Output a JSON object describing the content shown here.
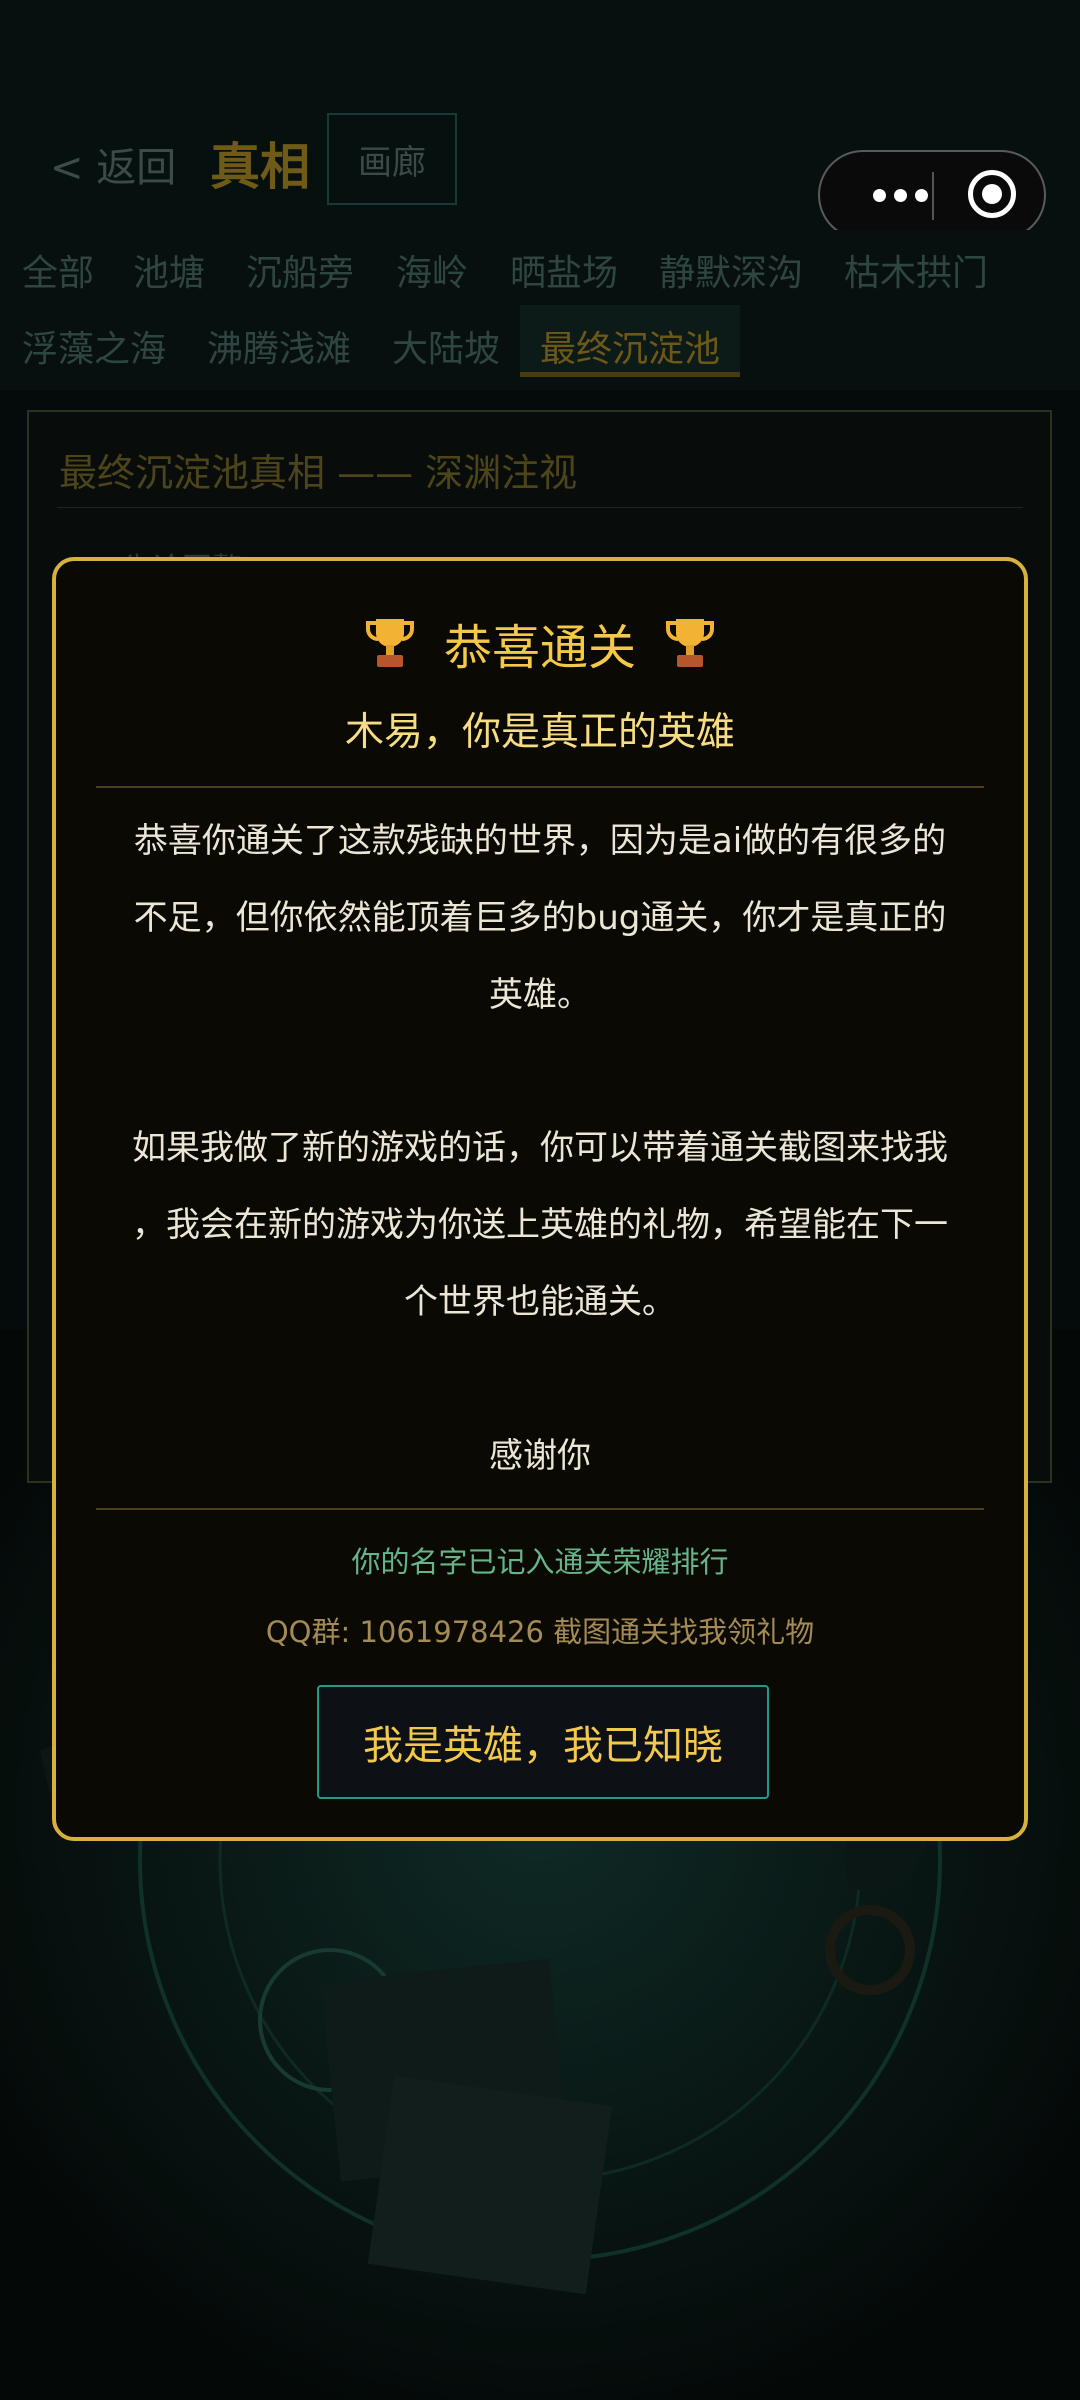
{
  "header": {
    "back_label": "< 返回",
    "title": "真相",
    "gallery_label": "画廊"
  },
  "capsule": {
    "more_icon": "more-dots-icon",
    "close_icon": "target-close-icon"
  },
  "tabs": [
    {
      "label": "全部"
    },
    {
      "label": "池塘"
    },
    {
      "label": "沉船旁"
    },
    {
      "label": "海岭"
    },
    {
      "label": "晒盐场"
    },
    {
      "label": "静默深沟"
    },
    {
      "label": "枯木拱门"
    },
    {
      "label": "浮藻之海"
    },
    {
      "label": "沸腾浅滩"
    },
    {
      "label": "大陆坡"
    },
    {
      "label": "最终沉淀池",
      "active": true
    }
  ],
  "content": {
    "heading": "最终沉淀池真相 —— 深渊注视",
    "card_label": "先论回赘"
  },
  "modal": {
    "title": "恭喜通关",
    "title_icon": "trophy-icon",
    "subtitle": "木易，你是真正的英雄",
    "paragraph1_lines": [
      "恭喜你通关了这款残缺的世界，因为是ai做的有很多的",
      "不足，但你依然能顶着巨多的bug通关，你才是真正的",
      "英雄。"
    ],
    "paragraph2_lines": [
      "如果我做了新的游戏的话，你可以带着通关截图来找我",
      "，我会在新的游戏为你送上英雄的礼物，希望能在下一",
      "个世界也能通关。"
    ],
    "thanks": "感谢你",
    "honor_text": "你的名字已记入通关荣耀排行",
    "qq_text": "QQ群: 1061978426  截图通关找我领礼物",
    "confirm_label": "我是英雄，我已知晓"
  },
  "colors": {
    "accent_gold": "#f4c94a",
    "modal_border": "#d6b13d",
    "button_border": "#1f9c88",
    "honor_green": "#67b489"
  }
}
